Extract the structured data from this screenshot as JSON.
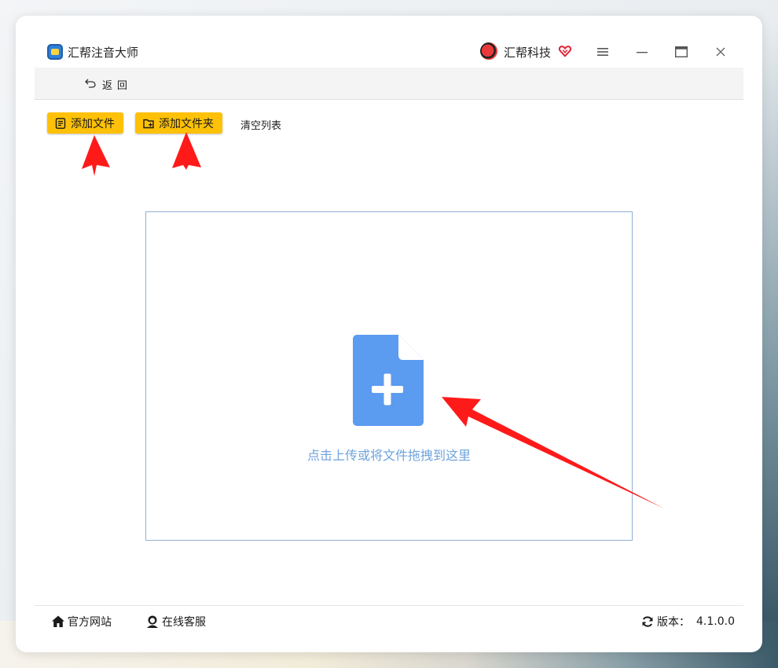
{
  "window": {
    "title": "汇帮注音大师",
    "brand": "汇帮科技"
  },
  "nav": {
    "back_label": "返回"
  },
  "toolbar": {
    "add_file_label": "添加文件",
    "add_folder_label": "添加文件夹",
    "clear_list_label": "清空列表"
  },
  "dropzone": {
    "hint": "点击上传或将文件拖拽到这里"
  },
  "statusbar": {
    "website_label": "官方网站",
    "support_label": "在线客服",
    "version_label": "版本：",
    "version_value": "4.1.0.0"
  },
  "colors": {
    "accent_yellow": "#ffc107",
    "drop_icon_blue": "#5b9bf0",
    "drop_text_blue": "#6fa3dc",
    "annotation_red": "#ff1a1a"
  },
  "icons": [
    "app-logo-icon",
    "brand-icon",
    "heart-icon",
    "menu-icon",
    "minimize-icon",
    "maximize-icon",
    "close-icon",
    "back-icon",
    "file-list-icon",
    "folder-add-icon",
    "file-plus-icon",
    "home-icon",
    "support-icon",
    "refresh-icon"
  ]
}
